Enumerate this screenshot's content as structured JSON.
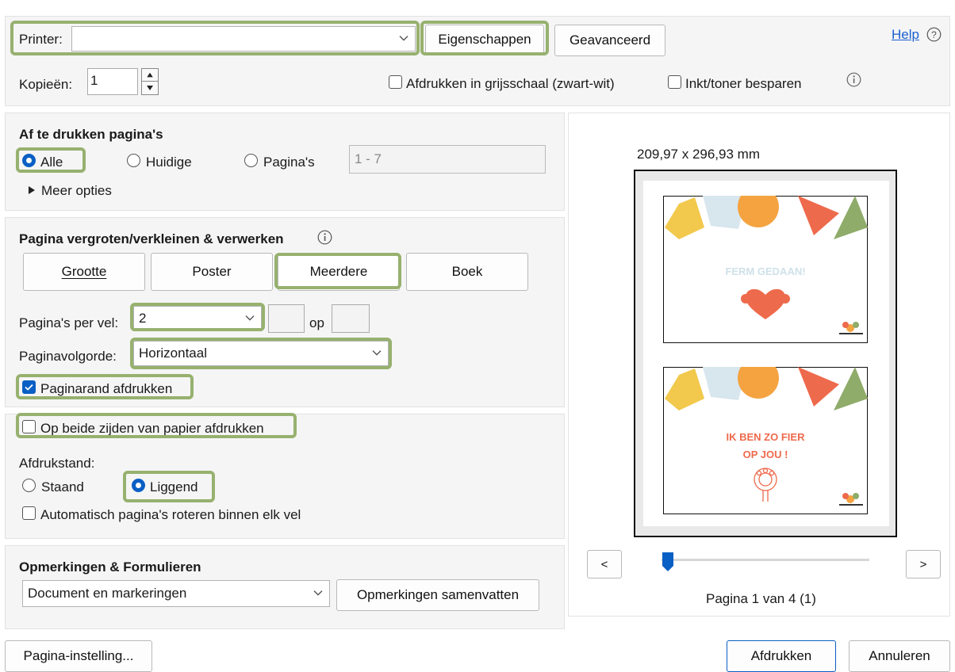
{
  "header": {
    "printer_label": "Printer:",
    "printer_value": "",
    "properties_button": "Eigenschappen",
    "advanced_button": "Geavanceerd",
    "help_link": "Help",
    "copies_label": "Kopieën:",
    "copies_value": "1",
    "grayscale_label": "Afdrukken in grijsschaal (zwart-wit)",
    "save_ink_label": "Inkt/toner besparen"
  },
  "pages_section": {
    "title": "Af te drukken pagina's",
    "options": [
      "Alle",
      "Huidige",
      "Pagina's"
    ],
    "selected": "Alle",
    "range_placeholder": "1 - 7",
    "more_options": "Meer opties"
  },
  "sizing_section": {
    "title": "Pagina vergroten/verkleinen & verwerken",
    "tabs": [
      "Grootte",
      "Poster",
      "Meerdere",
      "Boek"
    ],
    "active_tab": "Meerdere",
    "pages_per_sheet_label": "Pagina's per vel:",
    "pages_per_sheet_value": "2",
    "by_label": "op",
    "order_label": "Paginavolgorde:",
    "order_value": "Horizontaal",
    "print_border_label": "Paginarand afdrukken",
    "print_border_checked": true
  },
  "duplex_section": {
    "both_sides_label": "Op beide zijden van papier afdrukken",
    "orientation_label": "Afdrukstand:",
    "orientation_options": [
      "Staand",
      "Liggend"
    ],
    "orientation_selected": "Liggend",
    "auto_rotate_label": "Automatisch pagina's roteren binnen elk vel"
  },
  "comments_section": {
    "title": "Opmerkingen & Formulieren",
    "value": "Document en markeringen",
    "summarize_button": "Opmerkingen samenvatten"
  },
  "preview": {
    "paper_size": "209,97 x 296,93 mm",
    "card1_text": "FERM GEDAAN!",
    "card2_line1": "IK BEN ZO FIER",
    "card2_line2": "OP JOU !",
    "prev_button": "<",
    "next_button": ">",
    "page_status": "Pagina 1 van 4 (1)",
    "slider_position": 0
  },
  "footer": {
    "page_setup_button": "Pagina-instelling...",
    "print_button": "Afdrukken",
    "cancel_button": "Annuleren"
  },
  "colors": {
    "highlight": "#97b16f",
    "accent": "#0a5fc4",
    "yellow": "#f2c94c",
    "orange": "#f4a340",
    "coral": "#ee6a4c",
    "green": "#8fac6a",
    "light_blue": "#d8e6ee"
  }
}
